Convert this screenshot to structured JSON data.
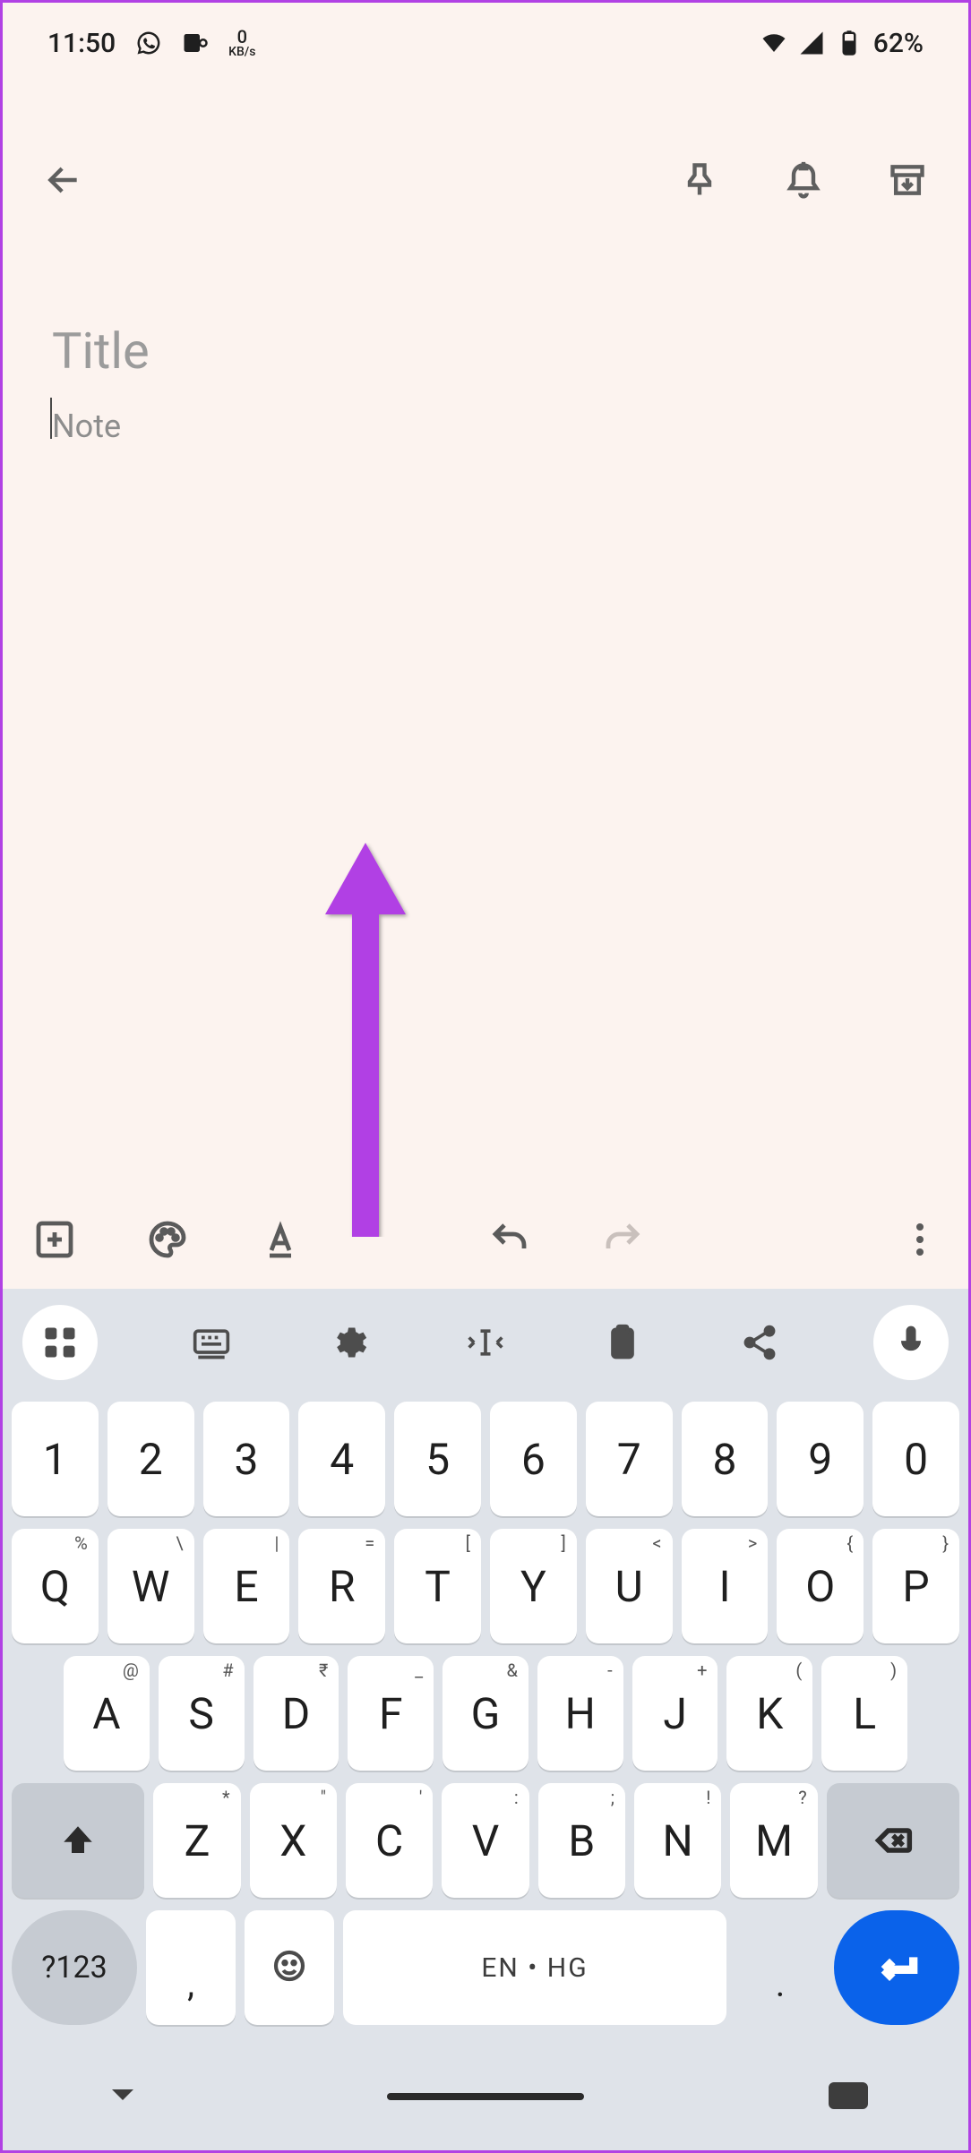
{
  "status": {
    "time": "11:50",
    "net_rate_value": "0",
    "net_rate_unit": "KB/s",
    "battery_text": "62%"
  },
  "note": {
    "title_placeholder": "Title",
    "title_value": "",
    "body_placeholder": "Note",
    "body_value": ""
  },
  "keyboard": {
    "row_num": [
      "1",
      "2",
      "3",
      "4",
      "5",
      "6",
      "7",
      "8",
      "9",
      "0"
    ],
    "row1": [
      {
        "k": "Q",
        "s": "%"
      },
      {
        "k": "W",
        "s": "\\"
      },
      {
        "k": "E",
        "s": "|"
      },
      {
        "k": "R",
        "s": "="
      },
      {
        "k": "T",
        "s": "["
      },
      {
        "k": "Y",
        "s": "]"
      },
      {
        "k": "U",
        "s": "<"
      },
      {
        "k": "I",
        "s": ">"
      },
      {
        "k": "O",
        "s": "{"
      },
      {
        "k": "P",
        "s": "}"
      }
    ],
    "row2": [
      {
        "k": "A",
        "s": "@"
      },
      {
        "k": "S",
        "s": "#"
      },
      {
        "k": "D",
        "s": "₹"
      },
      {
        "k": "F",
        "s": "_"
      },
      {
        "k": "G",
        "s": "&"
      },
      {
        "k": "H",
        "s": "-"
      },
      {
        "k": "J",
        "s": "+"
      },
      {
        "k": "K",
        "s": "("
      },
      {
        "k": "L",
        "s": ")"
      }
    ],
    "row3": [
      {
        "k": "Z",
        "s": "*"
      },
      {
        "k": "X",
        "s": "\""
      },
      {
        "k": "C",
        "s": "'"
      },
      {
        "k": "V",
        "s": ":"
      },
      {
        "k": "B",
        "s": ";"
      },
      {
        "k": "N",
        "s": "!"
      },
      {
        "k": "M",
        "s": "?"
      }
    ],
    "sym_label": "?123",
    "comma": ",",
    "dot": ".",
    "space_label": "EN • HG"
  },
  "annotation": {
    "color": "#b141e4"
  }
}
